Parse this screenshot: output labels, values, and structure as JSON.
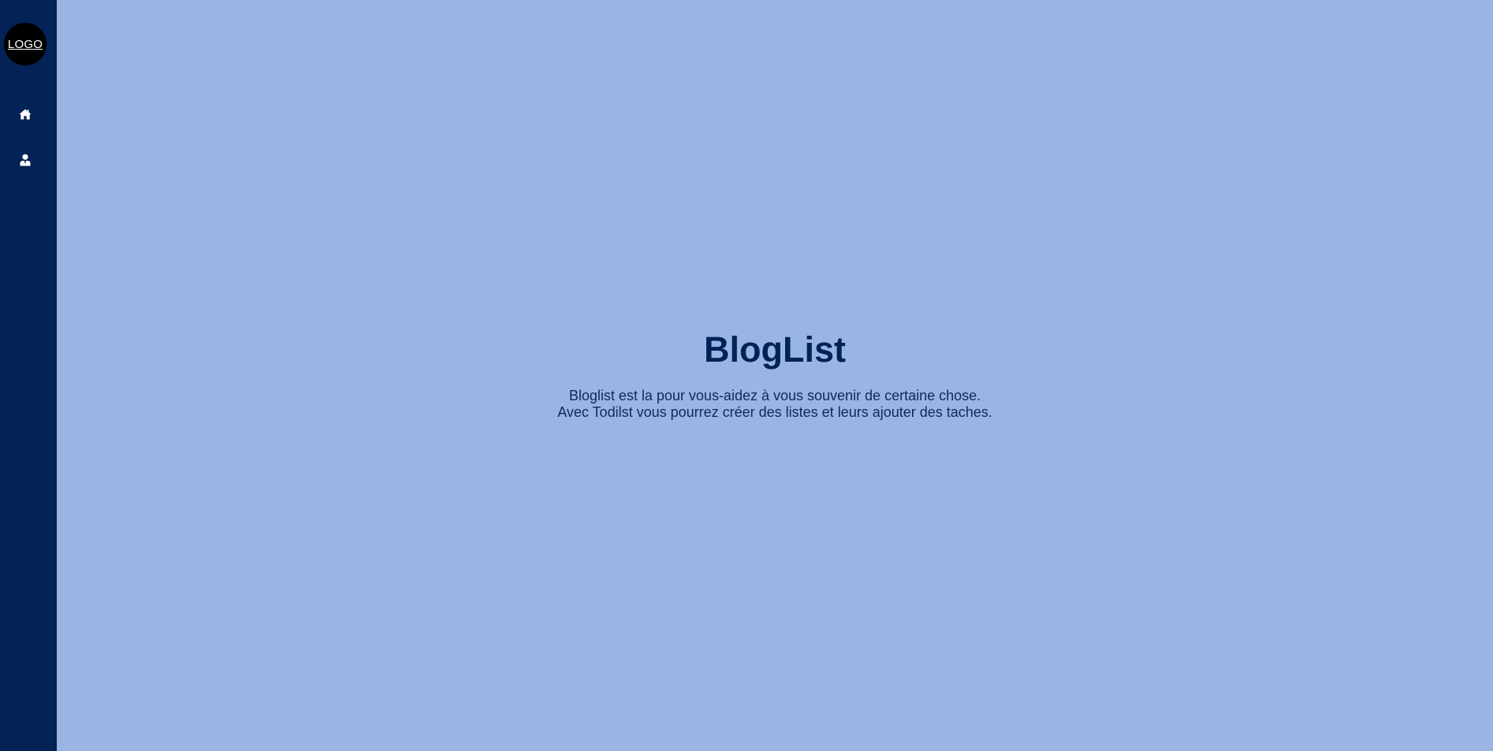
{
  "sidebar": {
    "logo_text": "LOGO",
    "items": [
      {
        "icon": "home-icon"
      },
      {
        "icon": "user-icon"
      }
    ]
  },
  "hero": {
    "title": "BlogList",
    "line1": "Bloglist est la pour vous-aidez à vous souvenir de certaine chose.",
    "line2": "Avec Todilst vous pourrez créer des listes et leurs ajouter des taches."
  },
  "colors": {
    "sidebar_bg": "#032255",
    "page_bg": "#9AB4E4",
    "title": "#032255",
    "logo_bg": "#000000"
  }
}
